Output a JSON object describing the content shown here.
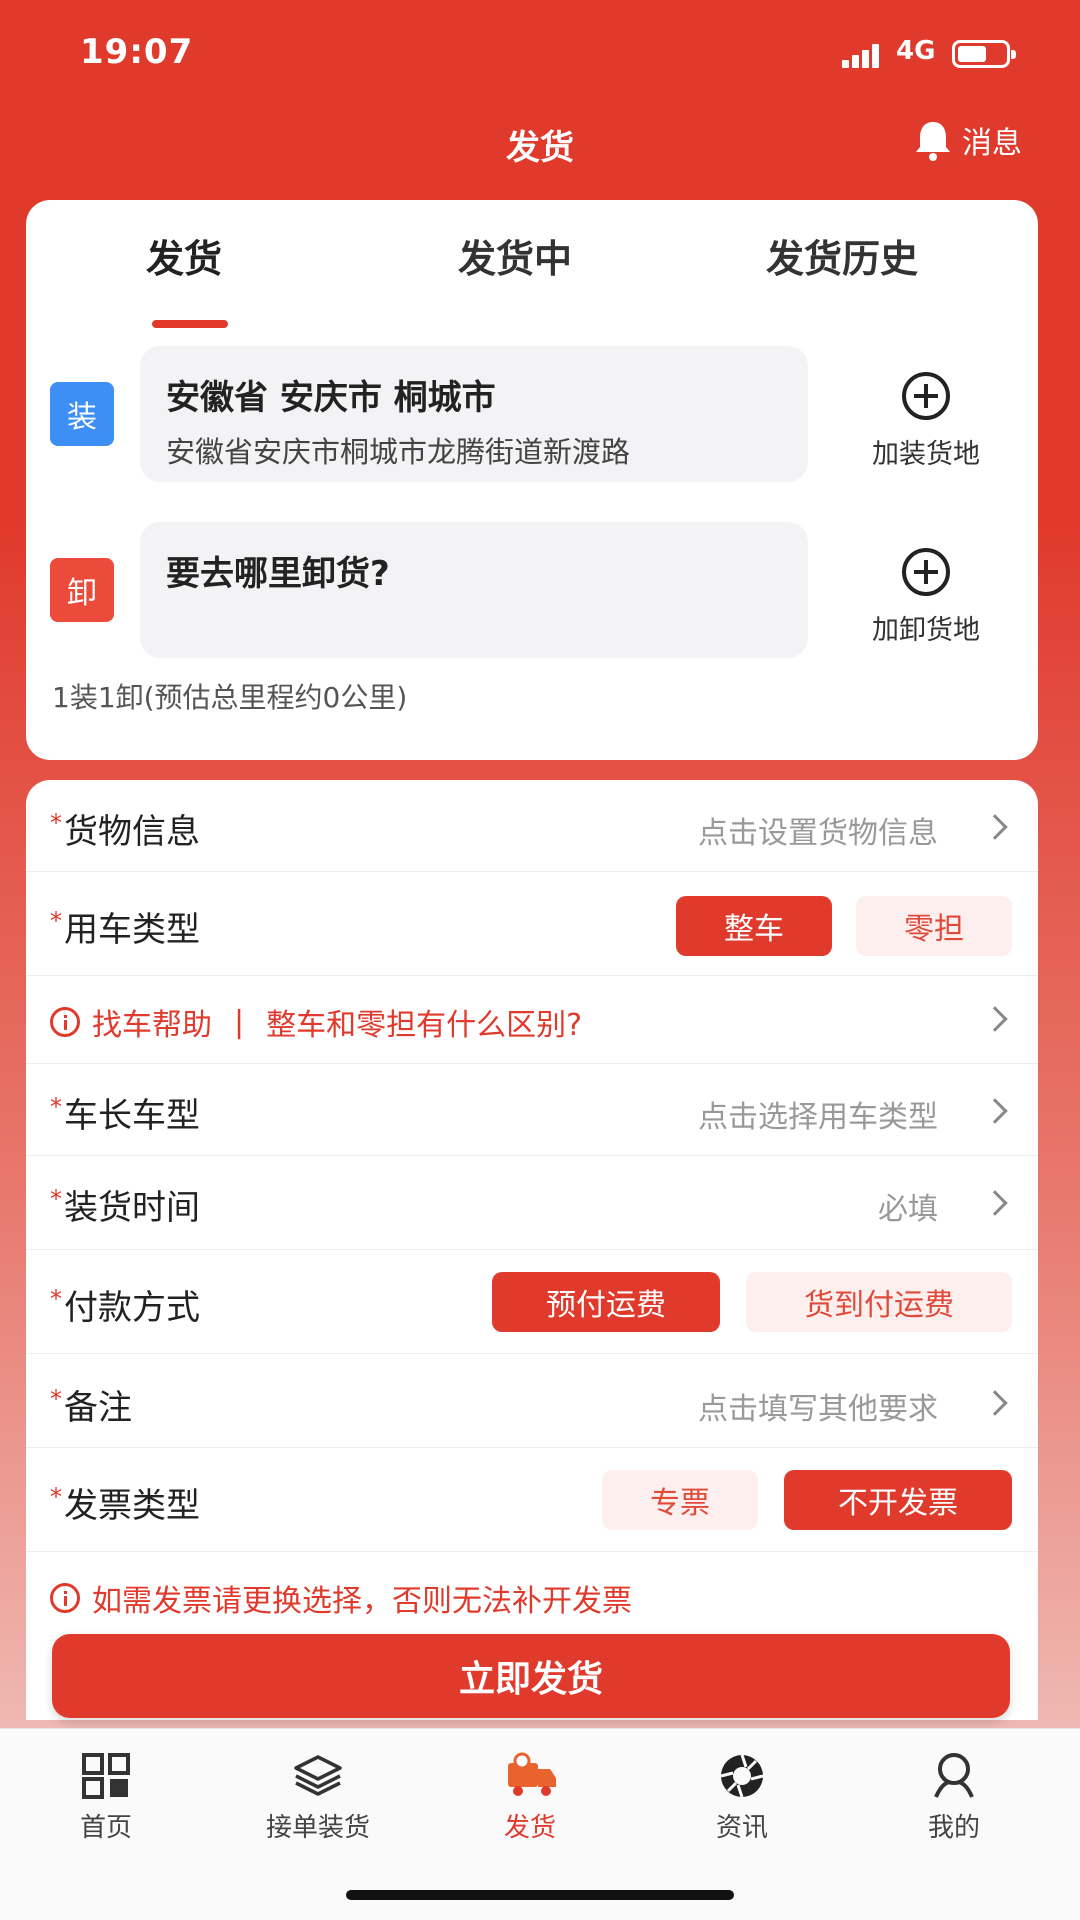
{
  "status_bar": {
    "time": "19:07",
    "network": "4G"
  },
  "nav": {
    "title": "发货",
    "message_label": "消息"
  },
  "tabs": [
    {
      "label": "发货",
      "active": true
    },
    {
      "label": "发货中",
      "active": false
    },
    {
      "label": "发货历史",
      "active": false
    }
  ],
  "load": {
    "badge": "装",
    "badge_color": "#3d8ff5",
    "title": "安徽省 安庆市 桐城市",
    "address": "安徽省安庆市桐城市龙腾街道新渡路",
    "add_label": "加装货地"
  },
  "unload": {
    "badge": "卸",
    "badge_color": "#ec4a3a",
    "placeholder": "要去哪里卸货?",
    "add_label": "加卸货地"
  },
  "summary": "1装1卸(预估总里程约0公里)",
  "form": {
    "cargo": {
      "label": "货物信息",
      "hint": "点击设置货物信息"
    },
    "vehicle_use": {
      "label": "用车类型",
      "options": [
        "整车",
        "零担"
      ],
      "selected": "整车"
    },
    "help": {
      "label": "找车帮助",
      "separator": "|",
      "question": "整车和零担有什么区别?"
    },
    "vehicle_length": {
      "label": "车长车型",
      "hint": "点击选择用车类型"
    },
    "load_time": {
      "label": "装货时间",
      "hint": "必填"
    },
    "payment": {
      "label": "付款方式",
      "options": [
        "预付运费",
        "货到付运费"
      ],
      "selected": "预付运费"
    },
    "remark": {
      "label": "备注",
      "hint": "点击填写其他要求"
    },
    "invoice": {
      "label": "发票类型",
      "options": [
        "专票",
        "不开发票"
      ],
      "selected": "不开发票"
    },
    "invoice_notice": "如需发票请更换选择，否则无法补开发票"
  },
  "submit_label": "立即发货",
  "tabbar": [
    {
      "label": "首页",
      "icon": "grid-icon",
      "active": false
    },
    {
      "label": "接单装货",
      "icon": "layers-icon",
      "active": false
    },
    {
      "label": "发货",
      "icon": "truck-icon",
      "active": true
    },
    {
      "label": "资讯",
      "icon": "aperture-icon",
      "active": false
    },
    {
      "label": "我的",
      "icon": "user-icon",
      "active": false
    }
  ],
  "colors": {
    "brand": "#e03a2c",
    "option_off_bg": "#fcefed"
  }
}
